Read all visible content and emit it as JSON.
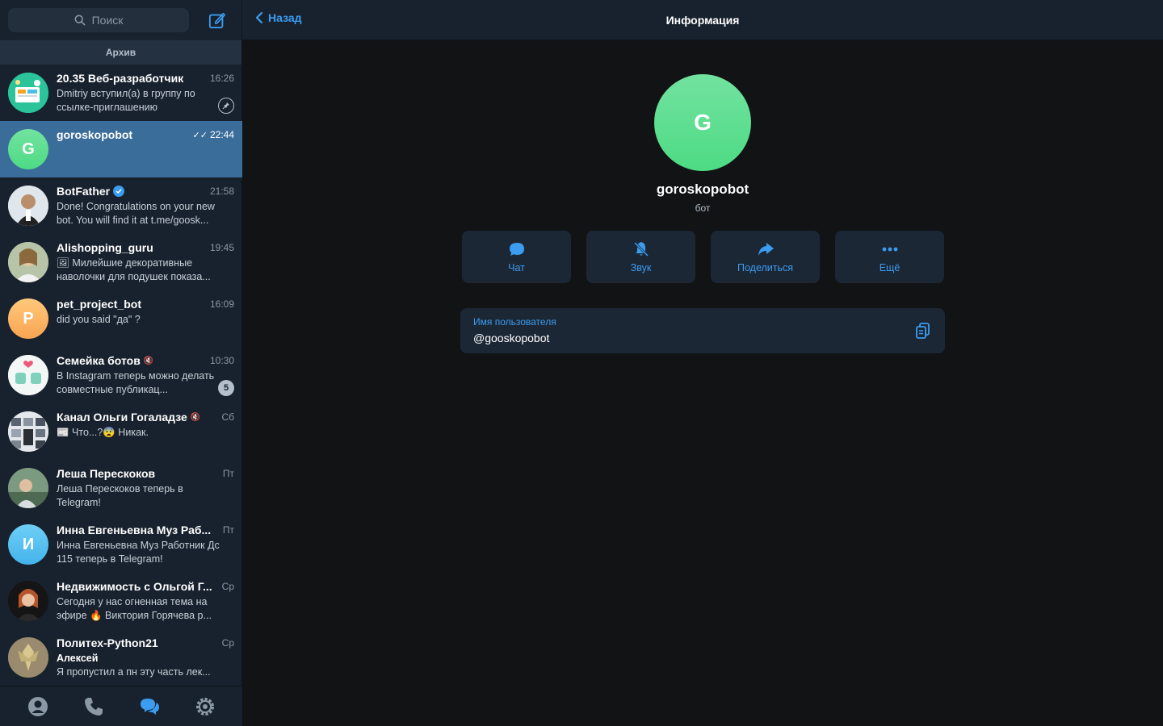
{
  "colors": {
    "accent": "#3b9cf0",
    "sidebar_bg": "#18222e",
    "main_bg": "#121314",
    "active_row": "#3a6d9a",
    "card_bg": "#1c2735"
  },
  "search": {
    "placeholder": "Поиск"
  },
  "archive": {
    "label": "Архив"
  },
  "chats": [
    {
      "name": "20.35 Веб-разработчик",
      "time": "16:26",
      "preview": "Dmitriy вступил(а) в группу по ссылке-приглашению",
      "avatar": "group-illustration",
      "pinned": true
    },
    {
      "name": "goroskopobot",
      "time": "22:44",
      "preview": "",
      "avatar_letter": "G",
      "active": true,
      "read": true
    },
    {
      "name": "BotFather",
      "time": "21:58",
      "preview": "Done! Congratulations on your new bot. You will find it at t.me/goosk...",
      "verified": true
    },
    {
      "name": "Alishopping_guru",
      "time": "19:45",
      "preview": "🖼 Милейшие декоративные наволочки для подушек показа..."
    },
    {
      "name": "pet_project_bot",
      "time": "16:09",
      "preview": "did you said \"да\" ?",
      "avatar_letter": "P"
    },
    {
      "name": "Семейка ботов",
      "time": "10:30",
      "preview": "В Instagram теперь можно делать совместные публикац...",
      "muted": true,
      "unread": "5"
    },
    {
      "name": "Канал Ольги Гогаладзе",
      "time": "Сб",
      "preview": "📰 Что...?😨 Никак.",
      "muted": true
    },
    {
      "name": "Леша Перескоков",
      "time": "Пт",
      "preview": "Леша Перескоков теперь в Telegram!"
    },
    {
      "name": "Инна Евгеньевна Муз Раб...",
      "time": "Пт",
      "preview": "Инна Евгеньевна Муз Работник Дс 115 теперь в Telegram!",
      "avatar_letter": "И"
    },
    {
      "name": "Недвижимость с Ольгой Г...",
      "time": "Ср",
      "preview": "Сегодня у нас огненная тема на эфире 🔥  Виктория Горячева р..."
    },
    {
      "name": "Политех-Python21",
      "time": "Ср",
      "sender": "Алексей",
      "preview": "Я пропустил а пн эту часть лек..."
    }
  ],
  "tabbar": {
    "items": [
      "contacts-icon",
      "calls-icon",
      "chats-icon",
      "settings-icon"
    ]
  },
  "header": {
    "back_label": "Назад",
    "title": "Информация"
  },
  "profile": {
    "avatar_letter": "G",
    "name": "goroskopobot",
    "subtitle": "бот"
  },
  "actions": [
    {
      "label": "Чат",
      "icon": "chat-bubble-icon"
    },
    {
      "label": "Звук",
      "icon": "bell-off-icon"
    },
    {
      "label": "Поделиться",
      "icon": "share-arrow-icon"
    },
    {
      "label": "Ещё",
      "icon": "more-dots-icon"
    }
  ],
  "info": {
    "label": "Имя пользователя",
    "value": "@gooskopobot"
  }
}
